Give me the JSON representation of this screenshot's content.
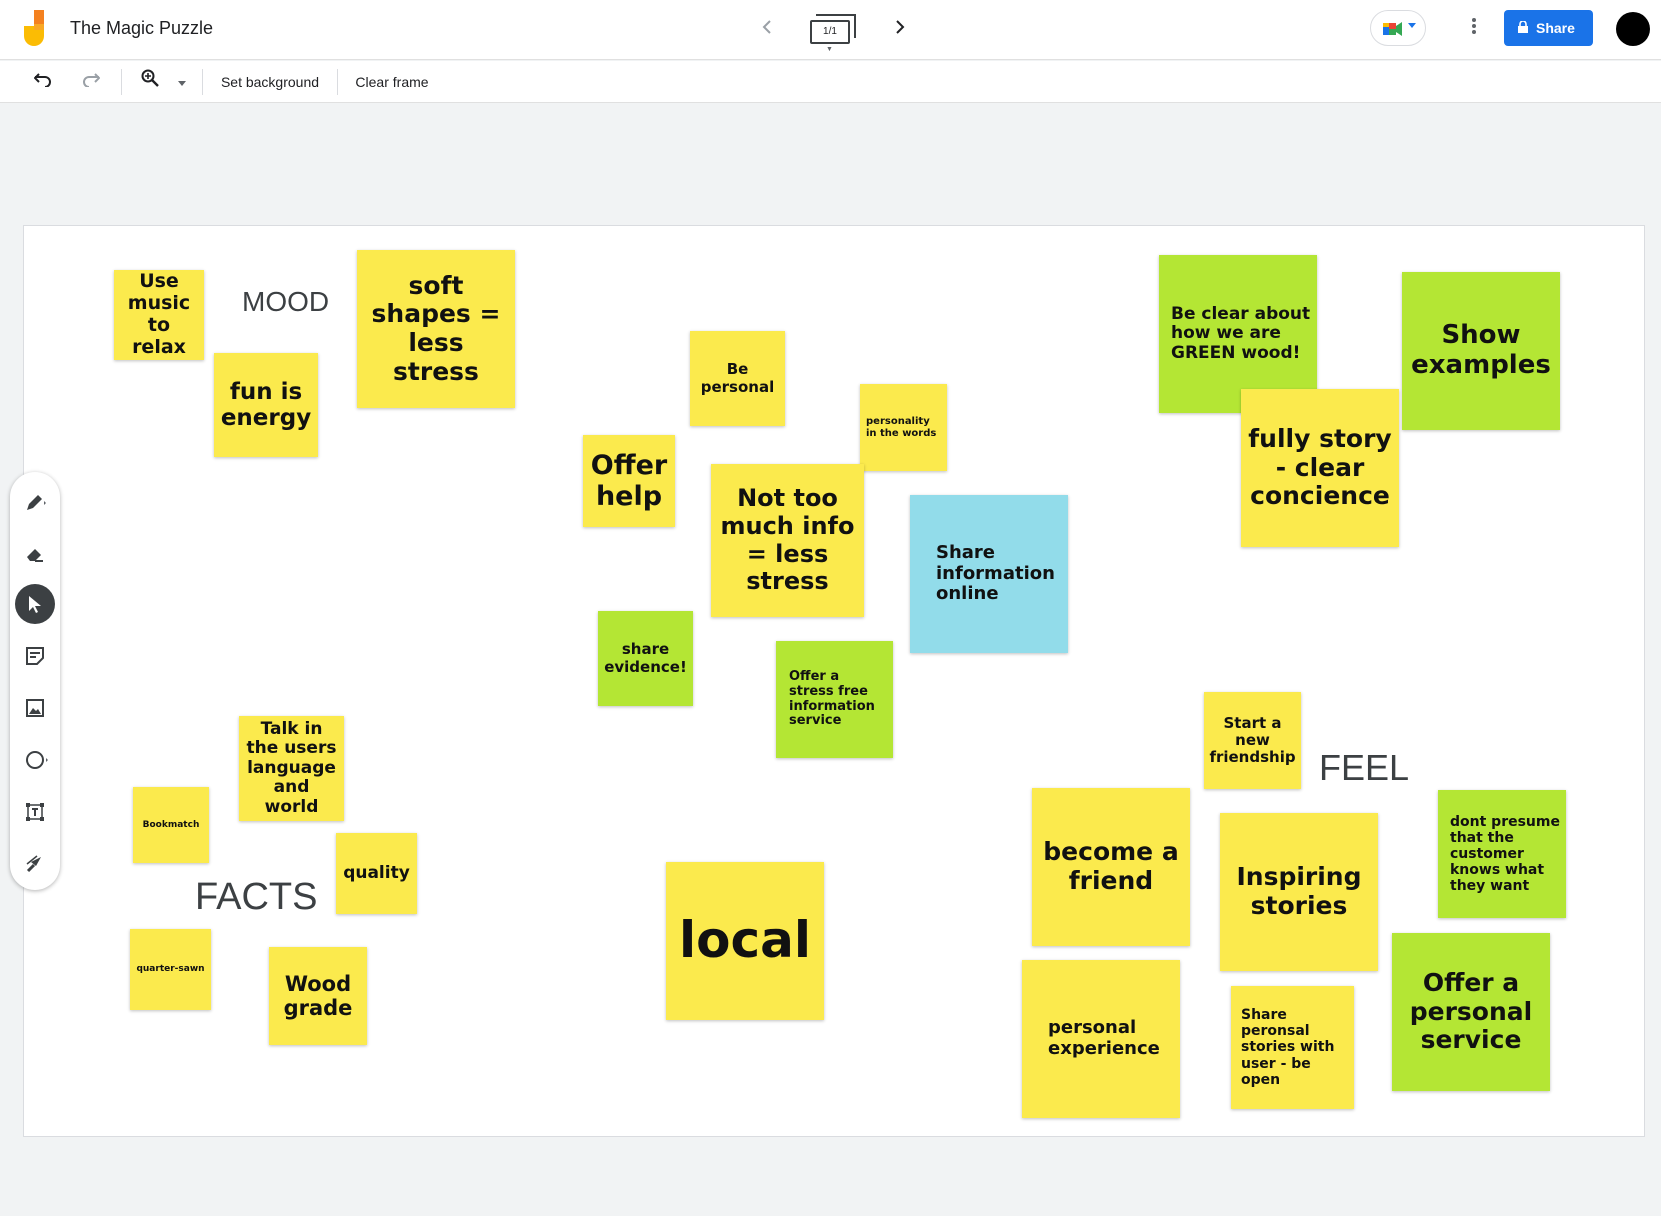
{
  "app": {
    "title": "The Magic Puzzle",
    "frame_indicator": "1/1",
    "share_label": "Share"
  },
  "toolbar": {
    "set_background": "Set background",
    "clear_frame": "Clear frame"
  },
  "colors": {
    "yellow_note": "#fbea4d",
    "green_note": "#b4e634",
    "blue_note": "#92dcea",
    "share_button": "#1a73e8"
  },
  "tools": [
    "pen-icon",
    "eraser-icon",
    "select-icon",
    "sticky-note-icon",
    "image-icon",
    "circle-icon",
    "text-box-icon",
    "laser-icon"
  ],
  "labels": {
    "mood": "MOOD",
    "facts": "FACTS",
    "feel": "FEEL"
  },
  "notes": {
    "use_music": "Use music to relax",
    "fun_is_energy": "fun is energy",
    "soft_shapes": "soft shapes = less stress",
    "be_personal": "Be personal",
    "personality_words": "personality in the words",
    "offer_help": "Offer help",
    "not_too_much": "Not too much info = less stress",
    "share_info_online": "Share information online",
    "share_evidence": "share evidence!",
    "offer_stress_free": "Offer a stress free information service",
    "be_clear_green": "Be clear about how we are GREEN wood!",
    "show_examples": "Show examples",
    "fully_story": "fully story - clear concience",
    "talk_users": "Talk in the users language and world",
    "bookmatch": "Bookmatch",
    "quality": "quality",
    "quarter_sawn": "quarter-sawn",
    "wood_grade": "Wood grade",
    "local": "local",
    "start_friendship": "Start a new friendship",
    "become_friend": "become a friend",
    "inspiring_stories": "Inspiring stories",
    "dont_presume": "dont presume that the customer knows what they want",
    "personal_experience": "personal experience",
    "share_personal": "Share peronsal stories with user - be open",
    "offer_personal": "Offer a personal service"
  }
}
